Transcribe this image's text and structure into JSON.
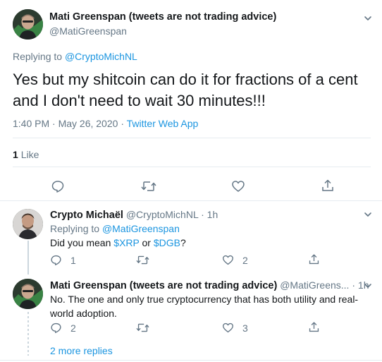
{
  "main_tweet": {
    "author_name": "Mati Greenspan (tweets are not trading advice)",
    "author_handle": "@MatiGreenspan",
    "replying_prefix": "Replying to",
    "replying_to": "@CryptoMichNL",
    "text": "Yes but my shitcoin can do it for fractions of a cent and I don't need to wait 30 minutes!!!",
    "time": "1:40 PM · May 26, 2020",
    "dot": "·",
    "source": "Twitter Web App",
    "likes_count": "1",
    "likes_label": "Like"
  },
  "replies": [
    {
      "author_name": "Crypto Michaël",
      "author_handle": "@CryptoMichNL",
      "dot": "·",
      "age": "1h",
      "replying_prefix": "Replying to",
      "replying_to": "@MatiGreenspan",
      "text_before": "Did you mean ",
      "cashtag1": "$XRP",
      "text_mid": " or ",
      "cashtag2": "$DGB",
      "text_after": "?",
      "reply_count": "1",
      "retweet_count": "",
      "like_count": "2"
    },
    {
      "author_name": "Mati Greenspan (tweets are not trading advice)",
      "author_handle": "@MatiGreens...",
      "dot": "·",
      "age": "1h",
      "text": "No. The one and only true cryptocurrency that has both utility and real-world adoption.",
      "reply_count": "2",
      "retweet_count": "",
      "like_count": "3"
    }
  ],
  "more_replies": "2 more replies",
  "colors": {
    "accent": "#1b95e0",
    "muted": "#657786",
    "divider": "#e6ecf0"
  },
  "icons": [
    "chevron-down-icon",
    "reply-icon",
    "retweet-icon",
    "like-icon",
    "share-icon"
  ]
}
